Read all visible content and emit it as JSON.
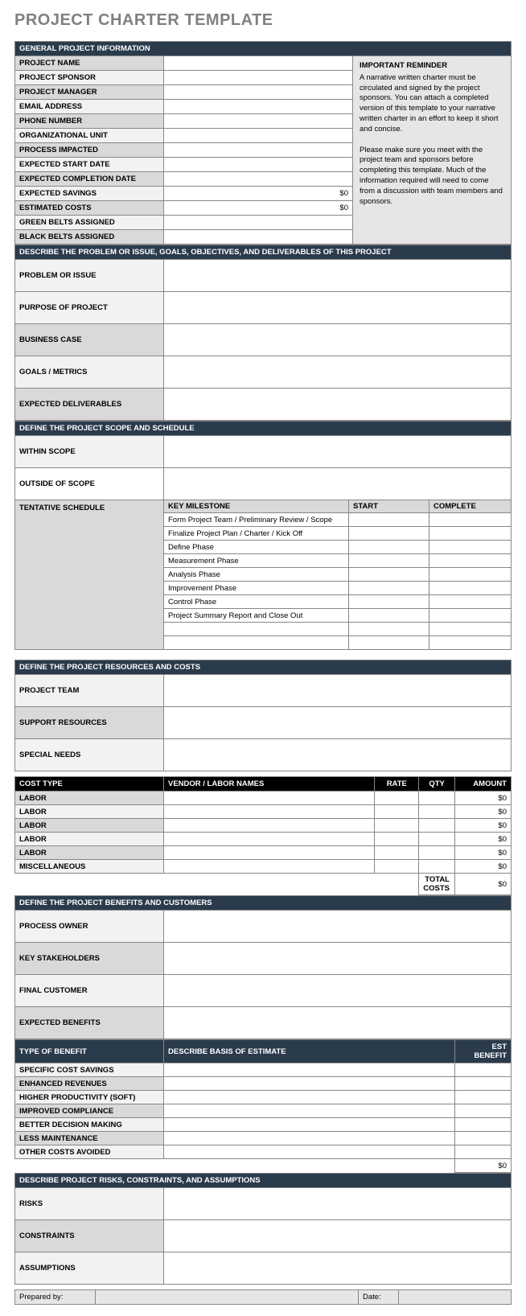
{
  "title": "PROJECT CHARTER TEMPLATE",
  "sec_general": {
    "header": "GENERAL PROJECT INFORMATION",
    "rows": [
      "PROJECT NAME",
      "PROJECT SPONSOR",
      "PROJECT MANAGER",
      "EMAIL ADDRESS",
      "PHONE NUMBER",
      "ORGANIZATIONAL UNIT",
      "PROCESS IMPACTED",
      "EXPECTED START DATE",
      "EXPECTED COMPLETION DATE",
      "EXPECTED SAVINGS",
      "ESTIMATED COSTS",
      "GREEN BELTS ASSIGNED",
      "BLACK BELTS ASSIGNED"
    ],
    "savings_val": "$0",
    "costs_val": "$0",
    "reminder_title": "IMPORTANT REMINDER",
    "reminder_p1": "A narrative written charter must be circulated and signed by the project sponsors. You can attach a completed version of this template to your narrative written charter in an effort to keep it short and concise.",
    "reminder_p2": "Please make sure you meet with the project team and sponsors before completing this template. Much of the information required will need to come from a discussion with team members and sponsors."
  },
  "sec_describe": {
    "header": "DESCRIBE THE PROBLEM OR ISSUE, GOALS, OBJECTIVES, AND DELIVERABLES OF THIS PROJECT",
    "rows": [
      "PROBLEM OR ISSUE",
      "PURPOSE OF PROJECT",
      "BUSINESS CASE",
      "GOALS / METRICS",
      "EXPECTED DELIVERABLES"
    ]
  },
  "sec_scope": {
    "header": "DEFINE THE PROJECT SCOPE AND SCHEDULE",
    "rows": [
      "WITHIN SCOPE",
      "OUTSIDE OF  SCOPE",
      "TENTATIVE SCHEDULE"
    ],
    "milestone_hdr": [
      "KEY MILESTONE",
      "START",
      "COMPLETE"
    ],
    "milestones": [
      "Form Project Team / Preliminary Review / Scope",
      "Finalize Project Plan / Charter / Kick Off",
      "Define Phase",
      "Measurement Phase",
      "Analysis Phase",
      "Improvement Phase",
      "Control Phase",
      "Project Summary Report and Close Out",
      "",
      ""
    ]
  },
  "sec_resources": {
    "header": "DEFINE THE PROJECT RESOURCES AND COSTS",
    "rows": [
      "PROJECT TEAM",
      "SUPPORT RESOURCES",
      "SPECIAL NEEDS"
    ]
  },
  "cost_table": {
    "headers": [
      "COST TYPE",
      "VENDOR / LABOR NAMES",
      "RATE",
      "QTY",
      "AMOUNT"
    ],
    "rows": [
      "LABOR",
      "LABOR",
      "LABOR",
      "LABOR",
      "LABOR",
      "MISCELLANEOUS"
    ],
    "amount_val": "$0",
    "total_label": "TOTAL COSTS",
    "total_val": "$0"
  },
  "sec_benefits": {
    "header": "DEFINE THE PROJECT BENEFITS AND CUSTOMERS",
    "rows": [
      "PROCESS OWNER",
      "KEY STAKEHOLDERS",
      "FINAL CUSTOMER",
      "EXPECTED BENEFITS"
    ]
  },
  "benefit_table": {
    "headers": [
      "TYPE OF BENEFIT",
      "DESCRIBE BASIS OF ESTIMATE",
      "EST BENEFIT"
    ],
    "rows": [
      "SPECIFIC COST SAVINGS",
      "ENHANCED REVENUES",
      "HIGHER PRODUCTIVITY (SOFT)",
      "IMPROVED COMPLIANCE",
      "BETTER DECISION MAKING",
      "LESS MAINTENANCE",
      "OTHER COSTS AVOIDED"
    ],
    "total_val": "$0"
  },
  "sec_risks": {
    "header": "DESCRIBE PROJECT RISKS, CONSTRAINTS, AND ASSUMPTIONS",
    "rows": [
      "RISKS",
      "CONSTRAINTS",
      "ASSUMPTIONS"
    ]
  },
  "footer": {
    "prepared": "Prepared by:",
    "date": "Date:"
  }
}
